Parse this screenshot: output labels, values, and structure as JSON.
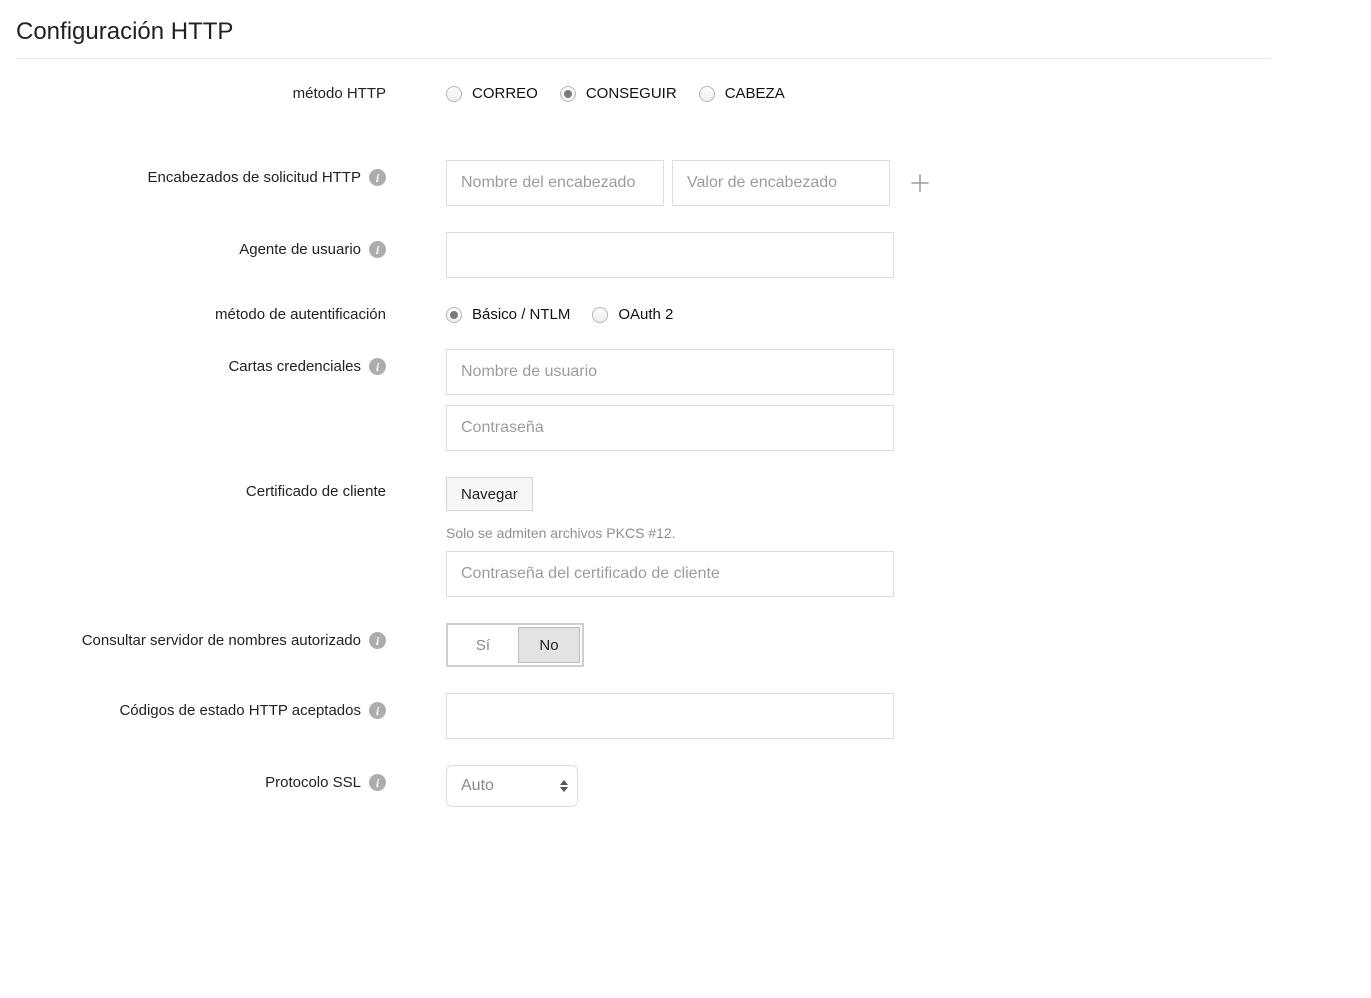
{
  "title": "Configuración HTTP",
  "labels": {
    "http_method": "método HTTP",
    "request_headers": "Encabezados de solicitud HTTP",
    "user_agent": "Agente de usuario",
    "auth_method": "método de autentificación",
    "credentials": "Cartas credenciales",
    "client_cert": "Certificado de cliente",
    "consult_ns": "Consultar servidor de nombres autorizado",
    "accepted_status": "Códigos de estado HTTP aceptados",
    "ssl_protocol": "Protocolo SSL"
  },
  "http_method": {
    "options": {
      "post": "CORREO",
      "get": "CONSEGUIR",
      "head": "CABEZA"
    },
    "selected": "get"
  },
  "headers": {
    "name_placeholder": "Nombre del encabezado",
    "value_placeholder": "Valor de encabezado"
  },
  "user_agent_value": "",
  "auth_method": {
    "options": {
      "basic": "Básico / NTLM",
      "oauth2": "OAuth 2"
    },
    "selected": "basic"
  },
  "credentials": {
    "username_placeholder": "Nombre de usuario",
    "password_placeholder": "Contraseña"
  },
  "client_cert": {
    "browse_label": "Navegar",
    "help_text": "Solo se admiten archivos PKCS #12.",
    "password_placeholder": "Contraseña del certificado de cliente"
  },
  "ns_toggle": {
    "yes": "Sí",
    "no": "No",
    "selected": "no"
  },
  "accepted_status_value": "",
  "ssl": {
    "selected_label": "Auto"
  }
}
